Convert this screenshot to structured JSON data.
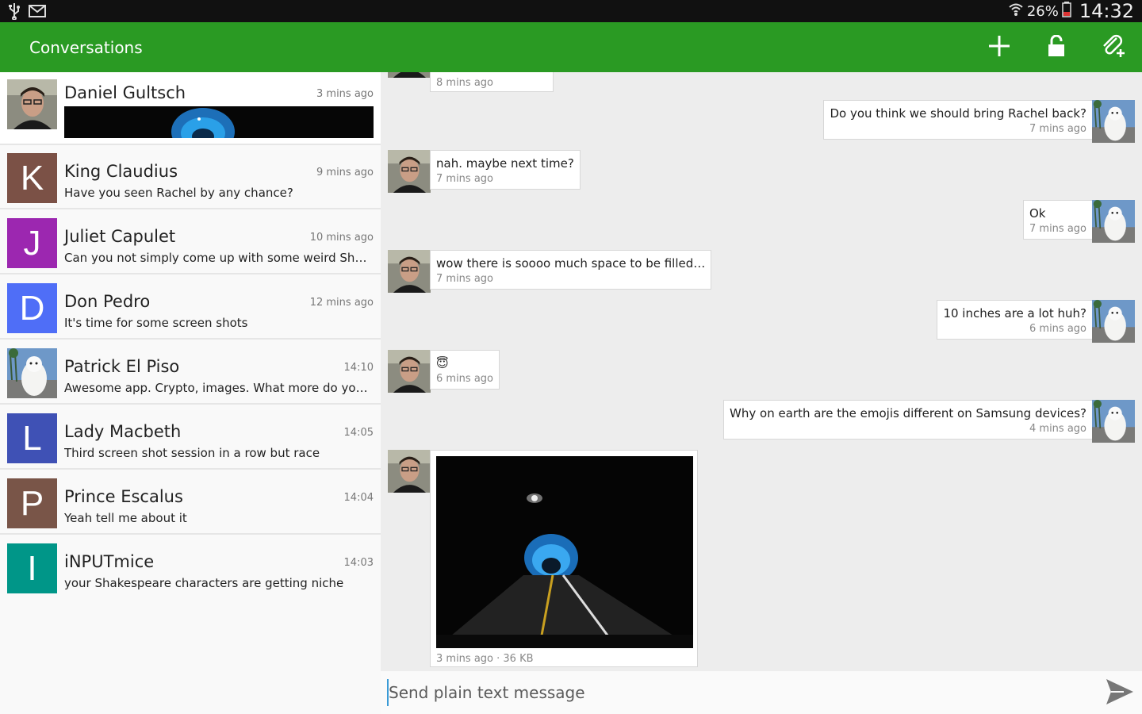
{
  "status_bar": {
    "battery": "26%",
    "time": "14:32",
    "icons": [
      "usb-icon",
      "gmail-icon",
      "wifi-icon",
      "battery-icon"
    ]
  },
  "app_bar": {
    "title": "Conversations",
    "actions": [
      "add-icon",
      "lock-icon",
      "attach-icon"
    ],
    "color": "#2a9a23"
  },
  "conversations": [
    {
      "name": "Daniel Gultsch",
      "time": "3 mins ago",
      "preview": "",
      "avatar": "photo-man",
      "preview_is_image": true
    },
    {
      "name": "King Claudius",
      "time": "9 mins ago",
      "preview": "Have you seen Rachel by any chance?",
      "letter": "K",
      "color": "#7b5146"
    },
    {
      "name": "Juliet Capulet",
      "time": "10 mins ago",
      "preview": "Can you not simply come up with some weird Shakes…",
      "letter": "J",
      "color": "#9c27b0"
    },
    {
      "name": "Don Pedro",
      "time": "12 mins ago",
      "preview": "It's time for some screen shots",
      "letter": "D",
      "color": "#4f6ef7"
    },
    {
      "name": "Patrick El Piso",
      "time": "14:10",
      "preview": "Awesome app. Crypto, images. What more do you wa…",
      "avatar": "photo-dog"
    },
    {
      "name": "Lady Macbeth",
      "time": "14:05",
      "preview": "Third screen shot session in a row but race",
      "letter": "L",
      "color": "#3f51b5"
    },
    {
      "name": "Prince Escalus",
      "time": "14:04",
      "preview": "Yeah tell me about it",
      "letter": "P",
      "color": "#795548"
    },
    {
      "name": "iNPUTmice",
      "time": "14:03",
      "preview": "your Shakespeare characters are getting niche",
      "letter": "I",
      "color": "#009688"
    }
  ],
  "messages": [
    {
      "dir": "in",
      "text": "",
      "meta": "8 mins ago"
    },
    {
      "dir": "out",
      "text": "Do you think we should bring Rachel back?",
      "meta": "7 mins ago"
    },
    {
      "dir": "in",
      "text": "nah. maybe next time?",
      "meta": "7 mins ago"
    },
    {
      "dir": "out",
      "text": "Ok",
      "meta": "7 mins ago"
    },
    {
      "dir": "in",
      "text": "wow there is soooo much space to be filled…",
      "meta": "7 mins ago"
    },
    {
      "dir": "out",
      "text": "10 inches are a lot huh?",
      "meta": "6 mins ago"
    },
    {
      "dir": "in",
      "text": "😇",
      "meta": "6 mins ago"
    },
    {
      "dir": "out",
      "text": "Why on earth are the emojis different on Samsung devices?",
      "meta": "4 mins ago"
    },
    {
      "dir": "in",
      "text": "",
      "meta": "3 mins ago · 36 KB",
      "is_image": true
    }
  ],
  "compose": {
    "placeholder": "Send plain text message",
    "send_icon": "send-icon"
  }
}
